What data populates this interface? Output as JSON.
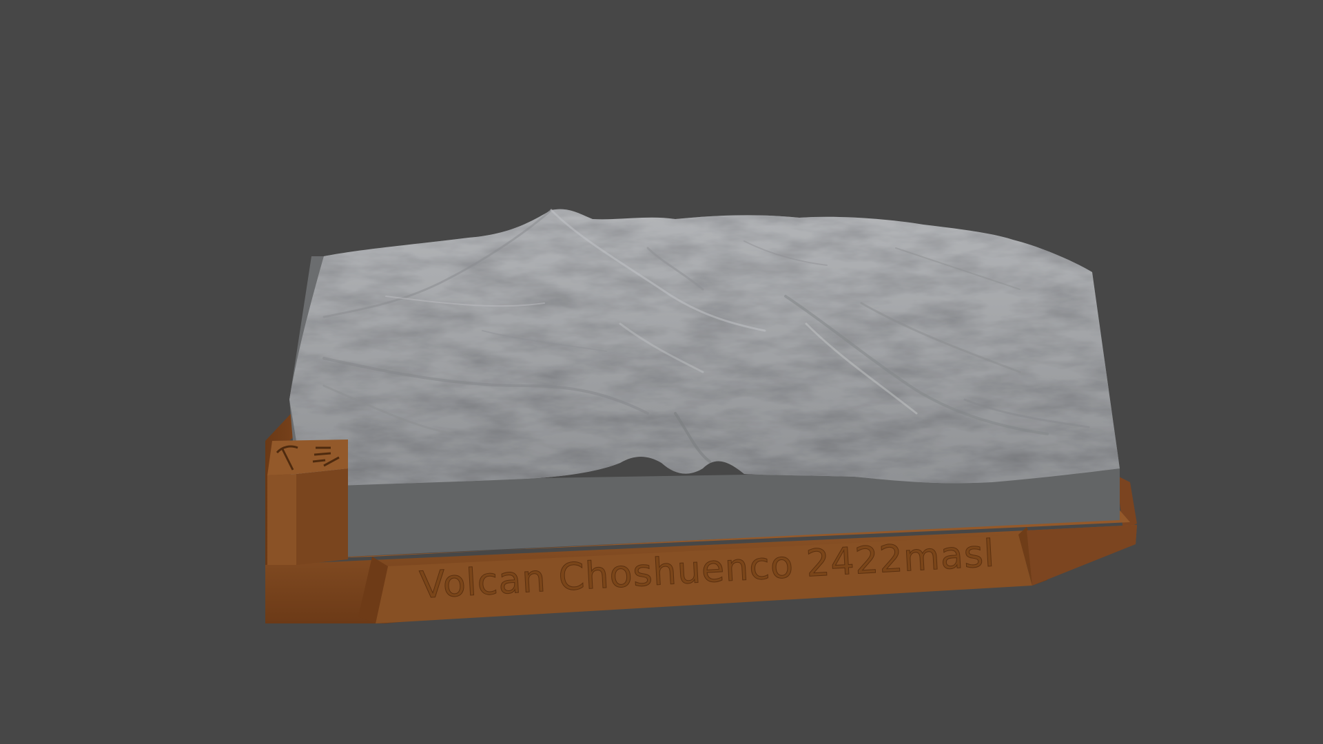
{
  "viewport": {
    "background_color": "#474747"
  },
  "model": {
    "base_color": "#7a461f",
    "base_shadow_color": "#5f3415",
    "terrain_color": "#9a9c9f",
    "terrain_side_color": "#636566",
    "plaque": {
      "label": "Volcan Choshuenco 2422masl"
    },
    "corner_post": {
      "icons": [
        "pickaxe-icon",
        "legend-lines-icon"
      ]
    }
  }
}
